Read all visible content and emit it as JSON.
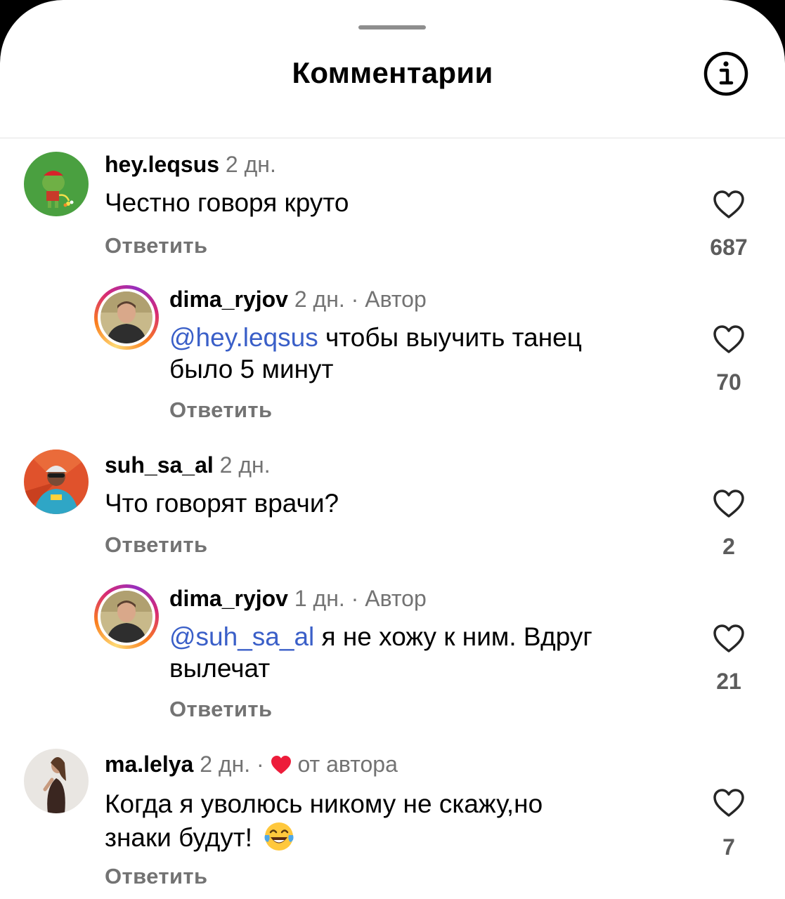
{
  "header": {
    "title": "Комментарии",
    "info_icon": "info-icon"
  },
  "comments": [
    {
      "username": "hey.leqsus",
      "time": "2 дн.",
      "text": "Честно говоря круто",
      "reply_label": "Ответить",
      "likes": "687",
      "avatar": "frog-avatar"
    },
    {
      "username": "dima_ryjov",
      "time": "2 дн.",
      "separator": "·",
      "badge": "Автор",
      "mention": "@hey.leqsus",
      "text_line1": " чтобы выучить танец",
      "text_line2": "было 5 минут",
      "reply_label": "Ответить",
      "likes": "70",
      "avatar": "man-avatar"
    },
    {
      "username": "suh_sa_al",
      "time": "2 дн.",
      "text": "Что говорят врачи?",
      "reply_label": "Ответить",
      "likes": "2",
      "avatar": "cyclist-avatar"
    },
    {
      "username": "dima_ryjov",
      "time": "1 дн.",
      "separator": "·",
      "badge": "Автор",
      "mention": "@suh_sa_al",
      "text_line1": " я не хожу к ним. Вдруг",
      "text_line2": "вылечат",
      "reply_label": "Ответить",
      "likes": "21",
      "avatar": "man-avatar"
    },
    {
      "username": "ma.lelya",
      "time": "2 дн.",
      "separator": "·",
      "badge": "от автора",
      "text_line1": "Когда я уволюсь никому не скажу,но",
      "text_line2": "знаки будут!",
      "emoji": "tears-of-joy-emoji",
      "reply_label": "Ответить",
      "likes": "7",
      "avatar": "woman-avatar"
    }
  ],
  "colors": {
    "mention": "#3a5fc8",
    "heart_red": "#ed1c3a",
    "secondary_text": "#737373"
  }
}
